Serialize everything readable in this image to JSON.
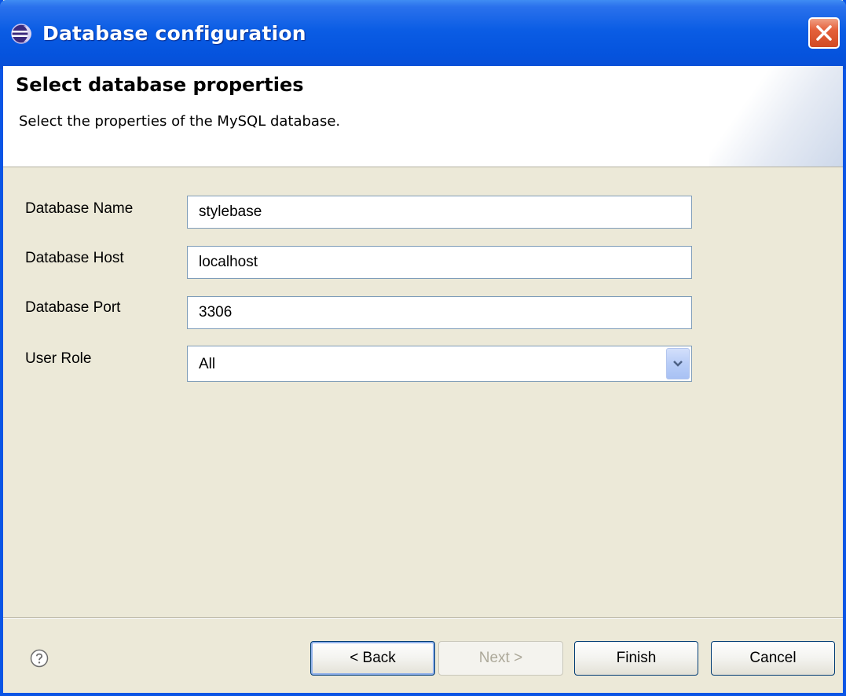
{
  "window": {
    "title": "Database configuration"
  },
  "header": {
    "title": "Select database properties",
    "description": "Select the properties of the MySQL database."
  },
  "form": {
    "database_name": {
      "label": "Database Name",
      "value": "stylebase"
    },
    "database_host": {
      "label": "Database Host",
      "value": "localhost"
    },
    "database_port": {
      "label": "Database Port",
      "value": "3306"
    },
    "user_role": {
      "label": "User Role",
      "value": "All"
    }
  },
  "buttons": {
    "back": "< Back",
    "next": "Next >",
    "finish": "Finish",
    "cancel": "Cancel"
  },
  "icons": {
    "window_icon": "eclipse-icon",
    "close": "close-icon",
    "help": "help-icon",
    "dropdown": "chevron-down-icon"
  },
  "colors": {
    "titlebar": "#0553dd",
    "dialog_background": "#ece9d8",
    "close_button": "#e4603a",
    "input_border": "#7f9db9"
  }
}
